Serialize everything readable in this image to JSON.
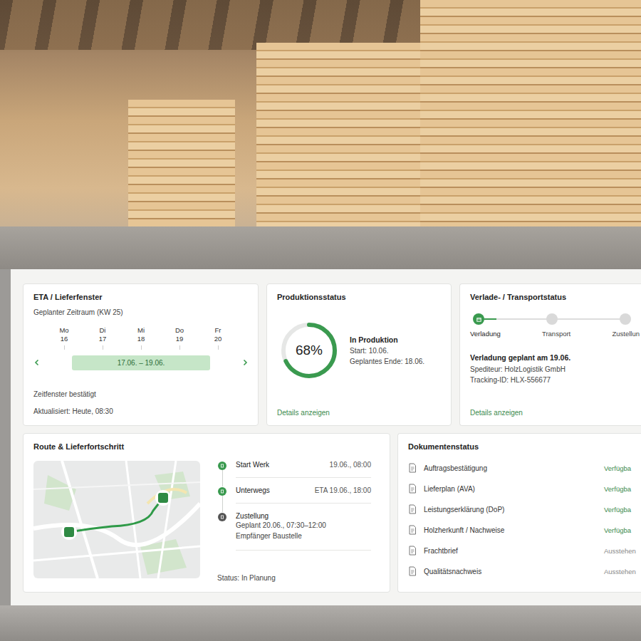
{
  "eta": {
    "title": "ETA / Lieferfenster",
    "subtitle": "Geplanter Zeitraum (KW 25)",
    "days": [
      {
        "weekday": "Mo",
        "date": "16",
        "selected": false
      },
      {
        "weekday": "Di",
        "date": "17",
        "selected": true
      },
      {
        "weekday": "Mi",
        "date": "18",
        "selected": true
      },
      {
        "weekday": "Do",
        "date": "19",
        "selected": true
      },
      {
        "weekday": "Fr",
        "date": "20",
        "selected": false
      }
    ],
    "range": "17.06. – 19.06.",
    "confirmed": "Zeitfenster bestätigt",
    "updated": "Aktualisiert: Heute, 08:30"
  },
  "production": {
    "title": "Produktionsstatus",
    "percent": "68%",
    "level": 0.68,
    "status": "In Produktion",
    "start": "Start: 10.06.",
    "end": "Geplantes Ende: 18.06.",
    "link": "Details anzeigen"
  },
  "transport": {
    "title": "Verlade- / Transportstatus",
    "steps": [
      {
        "label": "Verladung",
        "active": true
      },
      {
        "label": "Transport",
        "active": false
      },
      {
        "label": "Zustellun",
        "active": false
      }
    ],
    "level": 0.12,
    "plan": "Verladung geplant am 19.06.",
    "carrier": "Spediteur: HolzLogistik GmbH",
    "tracking": "Tracking-ID: HLX-556677",
    "link": "Details anzeigen"
  },
  "route": {
    "title": "Route & Lieferfortschritt",
    "stops": [
      {
        "label": "Start Werk",
        "time": "19.06., 08:00",
        "details": [],
        "completed": true
      },
      {
        "label": "Unterwegs",
        "time": "ETA 19.06., 18:00",
        "details": [],
        "completed": true
      },
      {
        "label": "Zustellung",
        "details": [
          "Geplant 20.06., 07:30–12:00",
          "Empfänger Baustelle"
        ],
        "completed": false
      }
    ],
    "status": "Status: In Planung"
  },
  "documents": {
    "title": "Dokumentenstatus",
    "items": [
      {
        "name": "Auftragsbestätigung",
        "status": "Verfügba",
        "available": true
      },
      {
        "name": "Lieferplan (AVA)",
        "status": "Verfügba",
        "available": true
      },
      {
        "name": "Leistungserklärung (DoP)",
        "status": "Verfügba",
        "available": true
      },
      {
        "name": "Holzherkunft / Nachweise",
        "status": "Verfügba",
        "available": true
      },
      {
        "name": "Frachtbrief",
        "status": "Ausstehen",
        "available": false
      },
      {
        "name": "Qualitätsnachweis",
        "status": "Ausstehen",
        "available": false
      }
    ]
  }
}
